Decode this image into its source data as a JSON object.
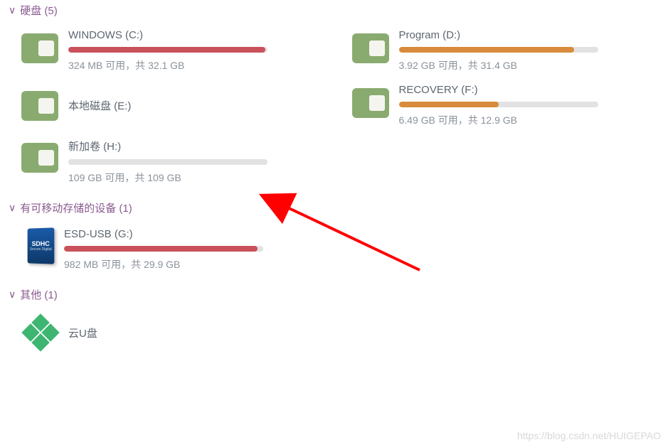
{
  "sections": {
    "hdd": {
      "title": "硬盘 (5)"
    },
    "removable": {
      "title": "有可移动存储的设备 (1)"
    },
    "other": {
      "title": "其他 (1)"
    }
  },
  "drives": {
    "c": {
      "name": "WINDOWS (C:)",
      "status": "324 MB 可用，共 32.1 GB",
      "fill_pct": 99,
      "fill_color": "fill-red"
    },
    "d": {
      "name": "Program (D:)",
      "status": "3.92 GB 可用，共 31.4 GB",
      "fill_pct": 88,
      "fill_color": "fill-orange"
    },
    "e": {
      "name": "本地磁盘 (E:)"
    },
    "f": {
      "name": "RECOVERY (F:)",
      "status": "6.49 GB 可用，共 12.9 GB",
      "fill_pct": 50,
      "fill_color": "fill-orange"
    },
    "h": {
      "name": "新加卷 (H:)",
      "status": "109 GB 可用，共 109 GB",
      "fill_pct": 1,
      "fill_color": "fill-gray"
    },
    "g": {
      "name": "ESD-USB (G:)",
      "status": "982 MB 可用，共 29.9 GB",
      "fill_pct": 97,
      "fill_color": "fill-red"
    },
    "cloud": {
      "name": "云U盘"
    }
  },
  "sd_label": {
    "top": "SDHC",
    "bottom": "Secure Digital"
  },
  "watermark": "https://blog.csdn.net/HUIGEPAO"
}
